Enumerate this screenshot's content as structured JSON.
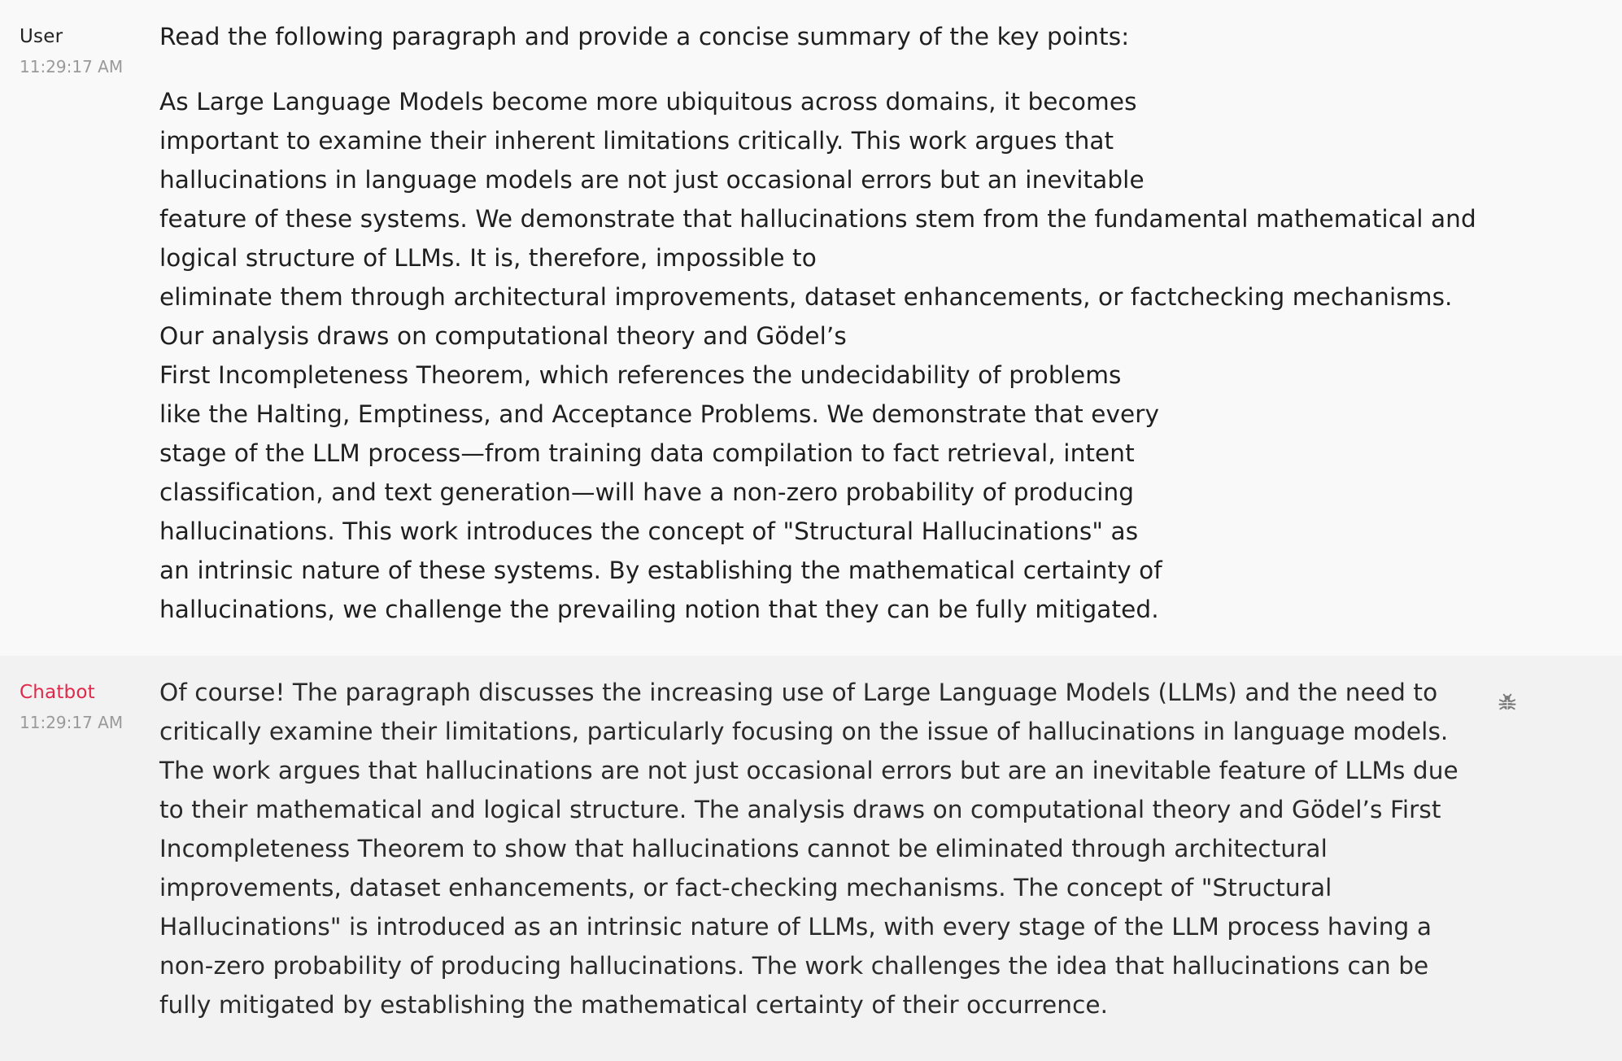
{
  "messages": {
    "user": {
      "author": "User",
      "time": "11:29:17 AM",
      "prompt": "Read the following paragraph and provide a concise summary of the key points:",
      "paragraph_lines": [
        "As Large Language Models become more ubiquitous across domains, it becomes",
        "important to examine their inherent limitations critically. This work argues that",
        "hallucinations in language models are not just occasional errors but an inevitable",
        "feature of these systems. We demonstrate that hallucinations stem from the fundamental mathematical and",
        "logical structure of LLMs. It is, therefore, impossible to",
        "eliminate them through architectural improvements, dataset enhancements, or factchecking mechanisms.",
        "Our analysis draws on computational theory and Gödel’s",
        "First Incompleteness Theorem, which references the undecidability of problems",
        "like the Halting, Emptiness, and Acceptance Problems. We demonstrate that every",
        "stage of the LLM process—from training data compilation to fact retrieval, intent",
        "classification, and text generation—will have a non-zero probability of producing",
        "hallucinations. This work introduces the concept of \"Structural Hallucinations\" as",
        "an intrinsic nature of these systems. By establishing the mathematical certainty of",
        "hallucinations, we challenge the prevailing notion that they can be fully mitigated."
      ]
    },
    "bot": {
      "author": "Chatbot",
      "time": "11:29:17 AM",
      "reply_lines": [
        "Of course! The paragraph discusses the increasing use of Large Language Models (LLMs) and the need to",
        "critically examine their limitations, particularly focusing on the issue of hallucinations in language models.",
        "The work argues that hallucinations are not just occasional errors but are an inevitable feature of LLMs due",
        "to their mathematical and logical structure. The analysis draws on computational theory and Gödel’s First",
        "Incompleteness Theorem to show that hallucinations cannot be eliminated through architectural",
        "improvements, dataset enhancements, or fact-checking mechanisms. The concept of \"Structural",
        "Hallucinations\" is introduced as an intrinsic nature of LLMs, with every stage of the LLM process having a",
        "non-zero probability of producing hallucinations. The work challenges the idea that hallucinations can be",
        "fully mitigated by establishing the mathematical certainty of their occurrence."
      ],
      "action_icon": "bug-icon"
    }
  },
  "colors": {
    "user_bg": "#f9f9f9",
    "bot_bg": "#f2f2f2",
    "bot_name": "#e0294a",
    "timestamp": "#9a9a9a",
    "icon": "#7a7a7a"
  }
}
